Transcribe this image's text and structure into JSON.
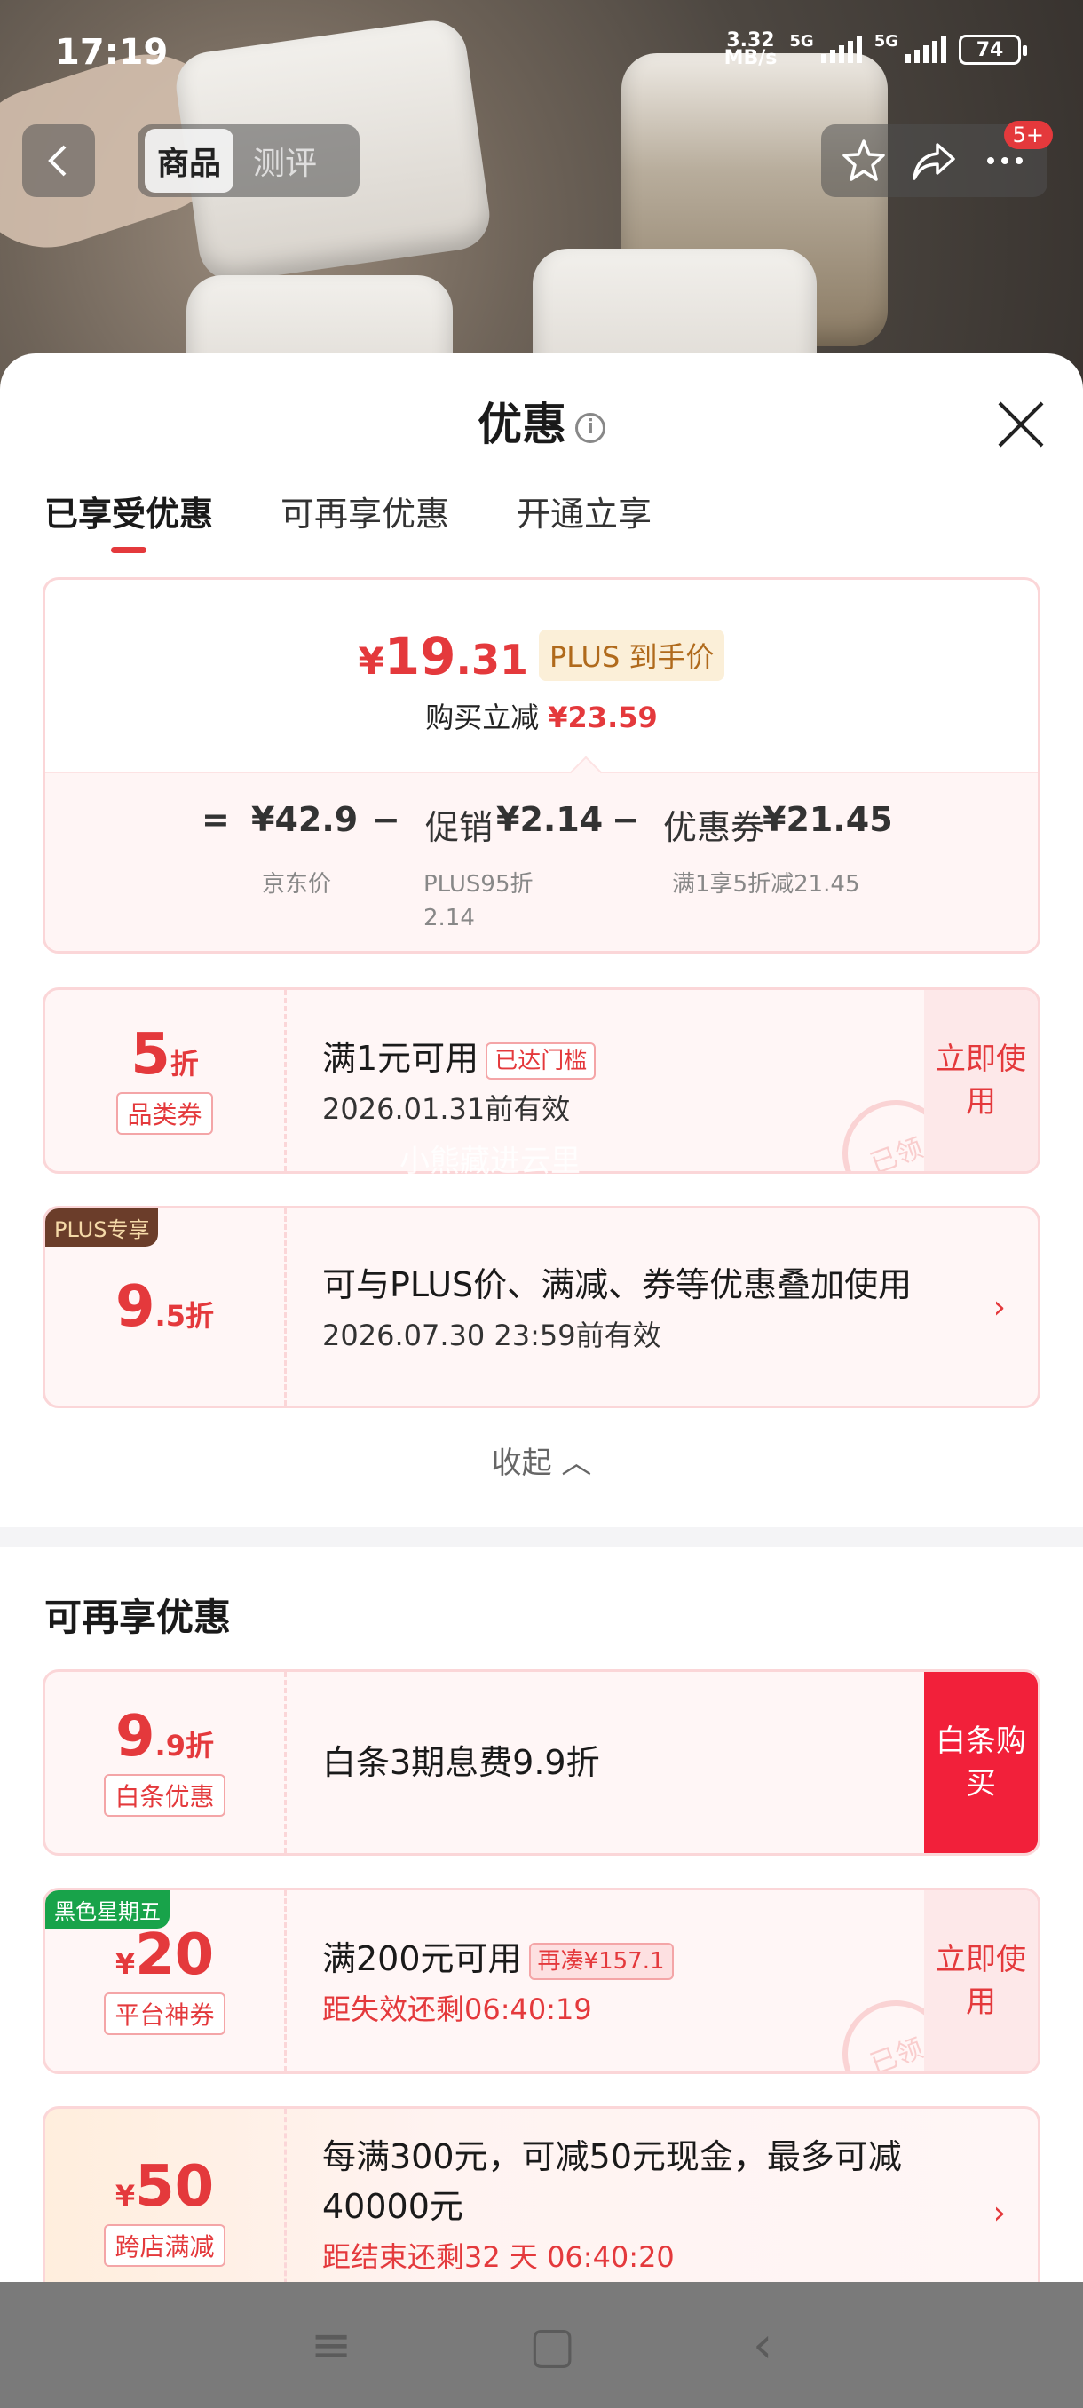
{
  "status_bar": {
    "time": "17:19",
    "net_speed_value": "3.32",
    "net_speed_unit": "MB/s",
    "network_1": "5G",
    "network_2": "5G",
    "battery": "74"
  },
  "top_nav": {
    "tabs": [
      {
        "label": "商品",
        "active": true
      },
      {
        "label": "测评",
        "active": false
      }
    ],
    "badge": "5+"
  },
  "sheet": {
    "title": "优惠",
    "tabs": [
      {
        "label": "已享受优惠",
        "active": true
      },
      {
        "label": "可再享优惠",
        "active": false
      },
      {
        "label": "开通立享",
        "active": false
      }
    ],
    "price_card": {
      "currency": "¥",
      "price_int": "19",
      "price_dec": ".31",
      "plus_label": "PLUS 到手价",
      "reduce_label": "购买立减",
      "reduce_value": "¥23.59",
      "equals": "=",
      "jd_price": "¥42.9",
      "minus_1": "−",
      "promo_label": "促销",
      "promo_value": "¥2.14",
      "minus_2": "−",
      "coupon_label": "优惠券",
      "coupon_value": "¥21.45",
      "jd_price_sub": "京东价",
      "promo_sub_1": "PLUS95折",
      "promo_sub_2": "2.14",
      "coupon_sub": "满1享5折减21.45"
    },
    "enjoyed_coupons": [
      {
        "value_big": "5",
        "value_unit": "折",
        "tag": "品类券",
        "title": "满1元可用",
        "pill": "已达门槛",
        "sub": "2026.01.31前有效",
        "action": "立即使用",
        "stamp": "已领"
      },
      {
        "corner": "PLUS专享",
        "value_big": "9",
        "value_unit": ".5折",
        "title": "可与PLUS价、满减、券等优惠叠加使用",
        "sub": "2026.07.30 23:59前有效",
        "arrow": "›"
      }
    ],
    "collapse_label": "收起",
    "watermark": "小熊藏进云里",
    "more_section_title": "可再享优惠",
    "more_coupons": [
      {
        "value_big": "9",
        "value_unit": ".9折",
        "tag": "白条优惠",
        "title": "白条3期息费9.9折",
        "action": "白条购买"
      },
      {
        "corner": "黑色星期五",
        "currency": "¥",
        "value_big": "20",
        "tag": "平台神券",
        "title": "满200元可用",
        "pill": "再凑¥157.1",
        "sub": "距失效还剩06:40:19",
        "action": "立即使用",
        "stamp": "已领"
      },
      {
        "currency": "¥",
        "value_big": "50",
        "tag": "跨店满减",
        "title": "每满300元，可减50元现金，最多可减40000元",
        "sub": "距结束还剩32 天 06:40:20",
        "arrow": "›"
      }
    ]
  },
  "system_nav": {
    "menu_icon": "≡",
    "home_icon": "▢",
    "back_icon": "‹"
  }
}
